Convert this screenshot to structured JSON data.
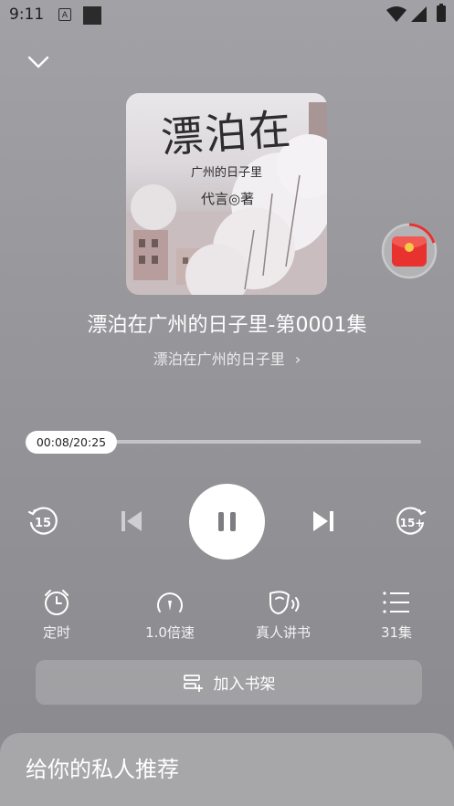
{
  "status_bar": {
    "time": "9:11",
    "notification_letter": "A"
  },
  "player": {
    "track_title": "漂泊在广州的日子里-第0001集",
    "album_name": "漂泊在广州的日子里",
    "album_arrow": "›",
    "progress": {
      "label": "00:08/20:25",
      "current": "00:08",
      "total": "20:25",
      "fraction": 0.0065
    },
    "cover": {
      "title": "漂泊在",
      "subtitle": "广州的日子里",
      "author": "代言◎著"
    },
    "controls": {
      "rewind_label": "15",
      "forward_label": "15+"
    },
    "features": [
      {
        "icon": "alarm-clock-icon",
        "label": "定时"
      },
      {
        "icon": "speedometer-icon",
        "label": "1.0倍速"
      },
      {
        "icon": "voice-head-icon",
        "label": "真人讲书"
      },
      {
        "icon": "list-icon",
        "label": "31集"
      }
    ],
    "shelf_button": "加入书架"
  },
  "recommendations": {
    "title": "给你的私人推荐"
  },
  "colors": {
    "background": "#97979b",
    "accent_red": "#e8322f",
    "white": "#ffffff"
  }
}
